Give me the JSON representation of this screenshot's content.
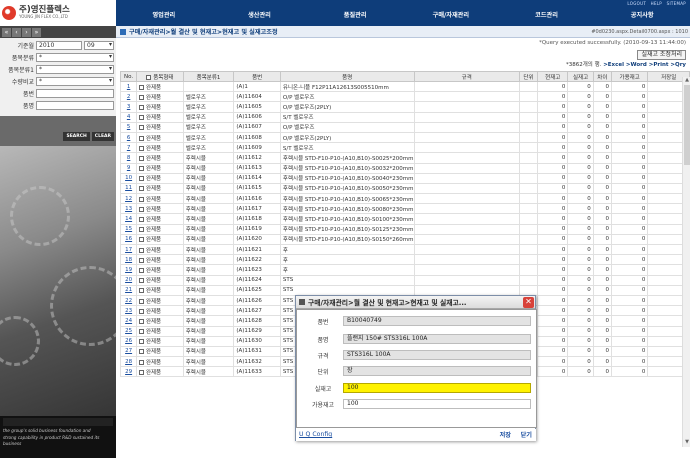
{
  "logo": {
    "name_ko": "주)영진플렉스",
    "name_en": "YOUNG JIN FLEX CO.,LTD"
  },
  "util_links": [
    "LOGOUT",
    "HELP",
    "SITEMAP"
  ],
  "menu": [
    "영업관리",
    "생산관리",
    "품질관리",
    "구매/자재관리",
    "코드관리",
    "공지사항"
  ],
  "breadcrumb": "구매/자재관리>월 결산 및 현재고>현재고 및 실재고조정",
  "breadcrumb_right": "#0d0230.aspx.Detail0700.aspx : 1010",
  "status_text": "*Query executed successfully. (2010-09-13 11:44:00)",
  "adjust_button": "실재고 조정처리",
  "export_line": {
    "count": "*3862개의 행.",
    "links": ">Excel >Word >Print >Qry"
  },
  "filters": {
    "year_label": "기준월",
    "year_value": "2010",
    "month_value": "09",
    "class_label": "품목분류",
    "class_value": "*",
    "class2_label": "품목분류1",
    "class2_value": "*",
    "qty_label": "수량비교",
    "qty_value": "*",
    "code_label": "품번",
    "name_label": "품명",
    "search_btn": "SEARCH",
    "clear_btn": "CLEAR"
  },
  "caption": [
    "the group's solid business foundation and",
    "strong capability in product R&D sustained its business"
  ],
  "table": {
    "headers": [
      "No.",
      "품목형태",
      "품목분류1",
      "품번",
      "품명",
      "규격",
      "단위",
      "현재고",
      "실재고",
      "차이",
      "가용재고",
      "저장일"
    ],
    "rows": [
      [
        "1",
        "완제품",
        "",
        "(A)1",
        "유니온-니플 F12P11A12613S005510mm",
        "",
        "",
        "0",
        "0",
        "0",
        "0",
        ""
      ],
      [
        "2",
        "완제품",
        "벨로우즈",
        "(A)11604",
        "O/P 벨로우즈",
        "",
        "",
        "0",
        "0",
        "0",
        "0",
        ""
      ],
      [
        "3",
        "완제품",
        "벨로우즈",
        "(A)11605",
        "O/P 벨로우즈(2PLY)",
        "",
        "",
        "0",
        "0",
        "0",
        "0",
        ""
      ],
      [
        "4",
        "완제품",
        "벨로우즈",
        "(A)11606",
        "S/T 벨로우즈",
        "",
        "",
        "0",
        "0",
        "0",
        "0",
        ""
      ],
      [
        "5",
        "완제품",
        "벨로우즈",
        "(A)11607",
        "O/P 벨로우즈",
        "",
        "",
        "0",
        "0",
        "0",
        "0",
        ""
      ],
      [
        "6",
        "완제품",
        "벨로우즈",
        "(A)11608",
        "O/P 벨로우즈(2PLY)",
        "",
        "",
        "0",
        "0",
        "0",
        "0",
        ""
      ],
      [
        "7",
        "완제품",
        "벨로우즈",
        "(A)11609",
        "S/T 벨로우즈",
        "",
        "",
        "0",
        "0",
        "0",
        "0",
        ""
      ],
      [
        "8",
        "완제품",
        "후렉시블",
        "(A)11612",
        "후렉시블 STD-F10-P10-(A10,B10)-S0025*200mm",
        "",
        "",
        "0",
        "0",
        "0",
        "0",
        ""
      ],
      [
        "9",
        "완제품",
        "후렉시블",
        "(A)11613",
        "후렉시블 STD-F10-P10-(A10,B10)-S0032*200mm",
        "",
        "",
        "0",
        "0",
        "0",
        "0",
        ""
      ],
      [
        "10",
        "완제품",
        "후렉시블",
        "(A)11614",
        "후렉시블 STD-F10-P10-(A10,B10)-S0040*230mm",
        "",
        "",
        "0",
        "0",
        "0",
        "0",
        ""
      ],
      [
        "11",
        "완제품",
        "후렉시블",
        "(A)11615",
        "후렉시블 STD-F10-P10-(A10,B10)-S0050*230mm",
        "",
        "",
        "0",
        "0",
        "0",
        "0",
        ""
      ],
      [
        "12",
        "완제품",
        "후렉시블",
        "(A)11616",
        "후렉시블 STD-F10-P10-(A10,B10)-S0065*230mm",
        "",
        "",
        "0",
        "0",
        "0",
        "0",
        ""
      ],
      [
        "13",
        "완제품",
        "후렉시블",
        "(A)11617",
        "후렉시블 STD-F10-P10-(A10,B10)-S0080*230mm",
        "",
        "",
        "0",
        "0",
        "0",
        "0",
        ""
      ],
      [
        "14",
        "완제품",
        "후렉시블",
        "(A)11618",
        "후렉시블 STD-F10-P10-(A10,B10)-S0100*230mm",
        "",
        "",
        "0",
        "0",
        "0",
        "0",
        ""
      ],
      [
        "15",
        "완제품",
        "후렉시블",
        "(A)11619",
        "후렉시블 STD-F10-P10-(A10,B10)-S0125*230mm",
        "",
        "",
        "0",
        "0",
        "0",
        "0",
        ""
      ],
      [
        "16",
        "완제품",
        "후렉시블",
        "(A)11620",
        "후렉시블 STD-F10-P10-(A10,B10)-S0150*260mm",
        "",
        "",
        "0",
        "0",
        "0",
        "0",
        ""
      ],
      [
        "17",
        "완제품",
        "후렉시블",
        "(A)11621",
        "후",
        "",
        "",
        "0",
        "0",
        "0",
        "0",
        ""
      ],
      [
        "18",
        "완제품",
        "후렉시블",
        "(A)11622",
        "후",
        "",
        "",
        "0",
        "0",
        "0",
        "0",
        ""
      ],
      [
        "19",
        "완제품",
        "후렉시블",
        "(A)11623",
        "후",
        "",
        "",
        "0",
        "0",
        "0",
        "0",
        ""
      ],
      [
        "20",
        "완제품",
        "후렉시블",
        "(A)11624",
        "STS",
        "",
        "",
        "0",
        "0",
        "0",
        "0",
        ""
      ],
      [
        "21",
        "완제품",
        "후렉시블",
        "(A)11625",
        "STS",
        "",
        "",
        "0",
        "0",
        "0",
        "0",
        ""
      ],
      [
        "22",
        "완제품",
        "후렉시블",
        "(A)11626",
        "STS",
        "",
        "",
        "0",
        "0",
        "0",
        "0",
        ""
      ],
      [
        "23",
        "완제품",
        "후렉시블",
        "(A)11627",
        "STS",
        "",
        "",
        "0",
        "0",
        "0",
        "0",
        ""
      ],
      [
        "24",
        "완제품",
        "후렉시블",
        "(A)11628",
        "STS",
        "",
        "",
        "0",
        "0",
        "0",
        "0",
        ""
      ],
      [
        "25",
        "완제품",
        "후렉시블",
        "(A)11629",
        "STS",
        "",
        "",
        "0",
        "0",
        "0",
        "0",
        ""
      ],
      [
        "26",
        "완제품",
        "후렉시블",
        "(A)11630",
        "STS",
        "",
        "",
        "0",
        "0",
        "0",
        "0",
        ""
      ],
      [
        "27",
        "완제품",
        "후렉시블",
        "(A)11631",
        "STS",
        "",
        "",
        "0",
        "0",
        "0",
        "0",
        ""
      ],
      [
        "28",
        "완제품",
        "후렉시블",
        "(A)11632",
        "STS",
        "",
        "",
        "0",
        "0",
        "0",
        "0",
        ""
      ],
      [
        "29",
        "완제품",
        "후렉시블",
        "(A)11633",
        "STS",
        "",
        "",
        "0",
        "0",
        "0",
        "0",
        ""
      ]
    ]
  },
  "dialog": {
    "title": "구매/자재관리>월 결산 및 현재고>현재고 및 실재고...",
    "fields": [
      {
        "label": "품번",
        "value": "B10040749",
        "style": "grey"
      },
      {
        "label": "품명",
        "value": "플랜지 150# STS316L 100A",
        "style": "grey"
      },
      {
        "label": "규격",
        "value": "STS316L 100A",
        "style": "grey"
      },
      {
        "label": "단위",
        "value": "장",
        "style": "grey"
      },
      {
        "label": "실재고",
        "value": "100",
        "style": "yellow"
      },
      {
        "label": "가용재고",
        "value": "100",
        "style": "white"
      }
    ],
    "link": "U Q Config",
    "save": "저장",
    "close": "닫기"
  }
}
